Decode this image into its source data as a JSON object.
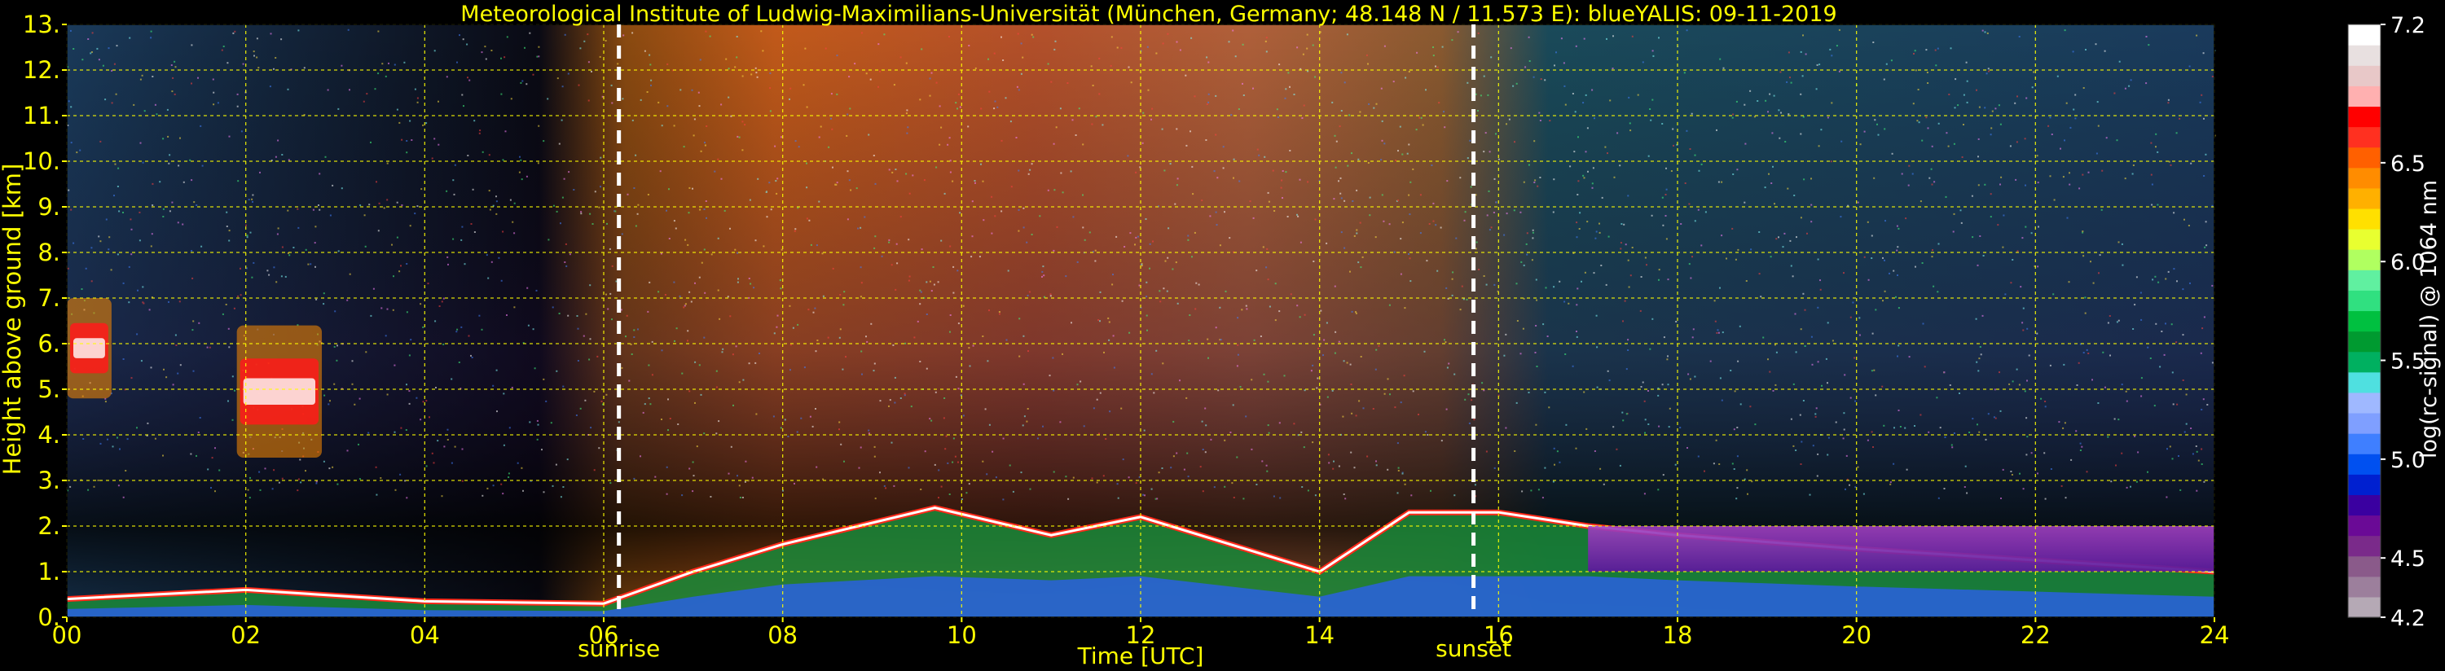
{
  "chart_data": {
    "type": "heatmap",
    "title": "Meteorological Institute of Ludwig-Maximilians-Universität (München, Germany; 48.148 N / 11.573 E):    blueYALIS: 09-11-2019",
    "xlabel": "Time [UTC]",
    "ylabel": "Height above ground [km]",
    "xlim": [
      0,
      24
    ],
    "ylim": [
      0,
      13
    ],
    "x_ticks": [
      "00",
      "02",
      "04",
      "06",
      "08",
      "10",
      "12",
      "14",
      "16",
      "18",
      "20",
      "22",
      "24"
    ],
    "y_ticks": [
      "0.",
      "1.",
      "2.",
      "3.",
      "4.",
      "5.",
      "6.",
      "7.",
      "8.",
      "9.",
      "10.",
      "11.",
      "12.",
      "13."
    ],
    "grid": true,
    "grid_color": "#ffff00",
    "events": [
      {
        "label": "sunrise",
        "x": 6.17
      },
      {
        "label": "sunset",
        "x": 15.72
      }
    ],
    "colorbar": {
      "label": "log(rc-signal) @ 1064 nm",
      "range": [
        4.2,
        7.2
      ],
      "ticks": [
        "4.2",
        "4.5",
        "5.0",
        "5.5",
        "6.0",
        "6.5",
        "7.2"
      ],
      "tick_values": [
        4.2,
        4.5,
        5.0,
        5.5,
        6.0,
        6.5,
        7.2
      ],
      "colors": [
        "#b5a9b5",
        "#9c7f9c",
        "#8a5a8a",
        "#7a2a8a",
        "#6a0a96",
        "#3a00a0",
        "#0020d0",
        "#0050f0",
        "#3f7fff",
        "#7f9fff",
        "#9fb8ff",
        "#4fe0e0",
        "#00b060",
        "#009a30",
        "#00c040",
        "#30e080",
        "#60f0a0",
        "#b0ff60",
        "#e8ff30",
        "#ffe000",
        "#ffb000",
        "#ff8c00",
        "#ff6000",
        "#ff3020",
        "#ff0000",
        "#ffb0b0",
        "#e8c8c8",
        "#e8e0e0",
        "#ffffff"
      ]
    },
    "features": [
      {
        "type": "boundary_layer",
        "description_points": [
          [
            0,
            0.4
          ],
          [
            2,
            0.6
          ],
          [
            4,
            0.35
          ],
          [
            6,
            0.3
          ],
          [
            7,
            1.0
          ],
          [
            8,
            1.6
          ],
          [
            9.7,
            2.4
          ],
          [
            11,
            1.8
          ],
          [
            12,
            2.2
          ],
          [
            14,
            1.0
          ],
          [
            15,
            2.3
          ],
          [
            16,
            2.3
          ],
          [
            17,
            2.0
          ],
          [
            18,
            1.8
          ],
          [
            20,
            1.5
          ],
          [
            24,
            1.0
          ]
        ]
      },
      {
        "type": "cloud",
        "x_range": [
          0,
          0.5
        ],
        "height": [
          4.8,
          7.0
        ]
      },
      {
        "type": "cloud",
        "x_range": [
          1.9,
          2.85
        ],
        "height": [
          3.5,
          6.4
        ]
      }
    ]
  }
}
